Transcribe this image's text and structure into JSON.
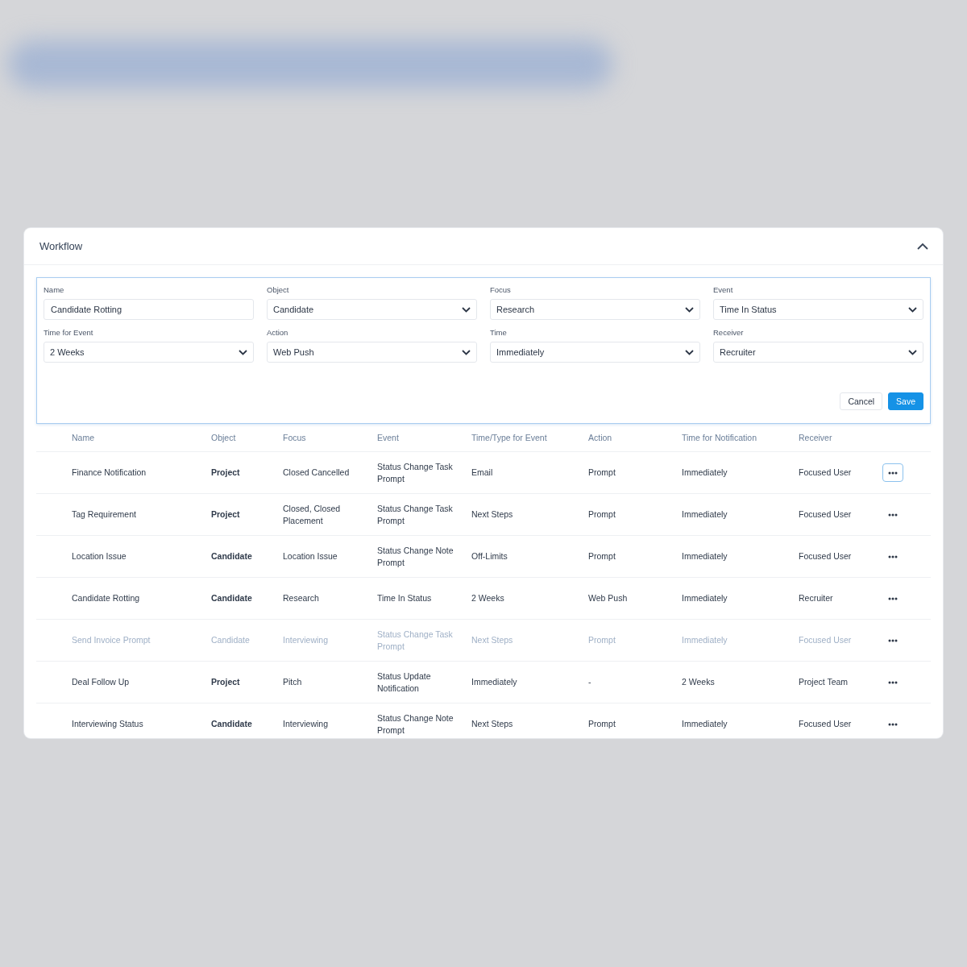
{
  "panel": {
    "title": "Workflow",
    "expanded": true
  },
  "form": {
    "fields": [
      {
        "label": "Name",
        "kind": "text",
        "value": "Candidate Rotting"
      },
      {
        "label": "Object",
        "kind": "select",
        "value": "Candidate"
      },
      {
        "label": "Focus",
        "kind": "select",
        "value": "Research"
      },
      {
        "label": "Event",
        "kind": "select",
        "value": "Time In Status"
      },
      {
        "label": "Time for Event",
        "kind": "select",
        "value": "2 Weeks"
      },
      {
        "label": "Action",
        "kind": "select",
        "value": "Web Push"
      },
      {
        "label": "Time",
        "kind": "select",
        "value": "Immediately"
      },
      {
        "label": "Receiver",
        "kind": "select",
        "value": "Recruiter"
      }
    ],
    "buttons": [
      {
        "label": "Cancel",
        "kind": "secondary"
      },
      {
        "label": "Save",
        "kind": "primary"
      }
    ]
  },
  "table": {
    "columns": [
      "Name",
      "Object",
      "Focus",
      "Event",
      "Time/Type for Event",
      "Action",
      "Time for Notification",
      "Receiver"
    ],
    "rows": [
      {
        "cells": [
          "Finance Notification",
          "Project",
          "Closed Cancelled",
          "Status Change Task Prompt",
          "Email",
          "Prompt",
          "Immediately",
          "Focused User"
        ],
        "disabled": false,
        "menu_focused": true
      },
      {
        "cells": [
          "Tag Requirement",
          "Project",
          "Closed, Closed Placement",
          "Status Change Task Prompt",
          "Next Steps",
          "Prompt",
          "Immediately",
          "Focused User"
        ],
        "disabled": false,
        "menu_focused": false
      },
      {
        "cells": [
          "Location Issue",
          "Candidate",
          "Location Issue",
          "Status Change Note Prompt",
          "Off-Limits",
          "Prompt",
          "Immediately",
          "Focused User"
        ],
        "disabled": false,
        "menu_focused": false
      },
      {
        "cells": [
          "Candidate Rotting",
          "Candidate",
          "Research",
          "Time In Status",
          "2 Weeks",
          "Web Push",
          "Immediately",
          "Recruiter"
        ],
        "disabled": false,
        "menu_focused": false
      },
      {
        "cells": [
          "Send Invoice Prompt",
          "Candidate",
          "Interviewing",
          "Status Change Task Prompt",
          "Next Steps",
          "Prompt",
          "Immediately",
          "Focused User"
        ],
        "disabled": true,
        "menu_focused": false
      },
      {
        "cells": [
          "Deal Follow Up",
          "Project",
          "Pitch",
          "Status Update Notification",
          "Immediately",
          "-",
          "2 Weeks",
          "Project Team"
        ],
        "disabled": false,
        "menu_focused": false
      },
      {
        "cells": [
          "Interviewing Status",
          "Candidate",
          "Interviewing",
          "Status Change Note Prompt",
          "Next Steps",
          "Prompt",
          "Immediately",
          "Focused User"
        ],
        "disabled": false,
        "menu_focused": false
      }
    ]
  }
}
